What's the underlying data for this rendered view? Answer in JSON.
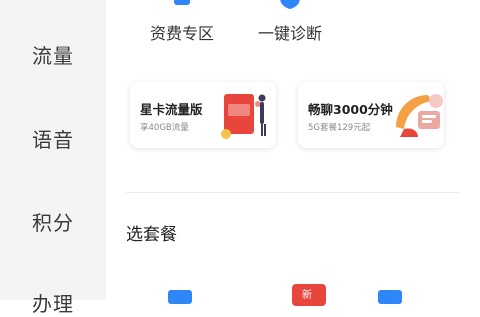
{
  "sidebar": {
    "items": [
      {
        "label": "流量"
      },
      {
        "label": "语音"
      },
      {
        "label": "积分"
      },
      {
        "label": "办理"
      }
    ]
  },
  "quick_actions": [
    {
      "label": "资费专区",
      "icon": "tariff-icon"
    },
    {
      "label": "一键诊断",
      "icon": "shield-diagnose-icon"
    }
  ],
  "promo_cards": [
    {
      "title": "星卡流量版",
      "subtitle": "享40GB流量",
      "icon": "red-envelope-icon"
    },
    {
      "title": "畅聊3000分钟",
      "subtitle": "5G套餐129元起",
      "icon": "phone-handset-icon"
    }
  ],
  "packages": {
    "section_title": "选套餐",
    "badge": "新"
  },
  "colors": {
    "sidebar_bg": "#f4f4f5",
    "accent_blue": "#2f86f6",
    "accent_red": "#e8453c",
    "accent_orange": "#f5a045"
  }
}
